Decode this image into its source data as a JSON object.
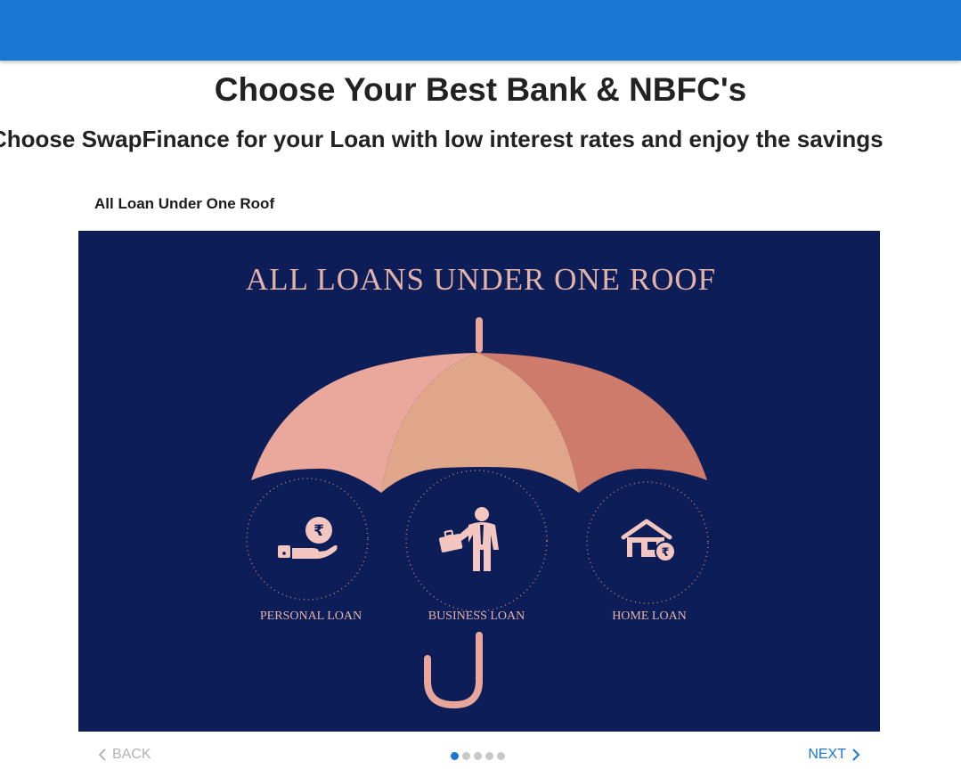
{
  "header": {
    "title": "Choose Your Best Bank & NBFC's",
    "subtitle": "Choose SwapFinance for your Loan with low interest rates and enjoy the savings"
  },
  "step": {
    "label": "All Loan Under One Roof"
  },
  "slide": {
    "heading": "ALL LOANS UNDER ONE ROOF",
    "items": [
      {
        "label": "PERSONAL LOAN",
        "icon": "hand-rupee-icon"
      },
      {
        "label": "BUSINESS LOAN",
        "icon": "businessman-icon"
      },
      {
        "label": "HOME LOAN",
        "icon": "house-rupee-icon"
      }
    ],
    "colors": {
      "background": "#0c1d57",
      "accent": "#e8a79a"
    }
  },
  "stepper": {
    "back_label": "BACK",
    "next_label": "NEXT",
    "active_step": 1,
    "total_steps": 5
  },
  "colors": {
    "primary": "#1976d2",
    "disabled": "#b4b4b4"
  }
}
